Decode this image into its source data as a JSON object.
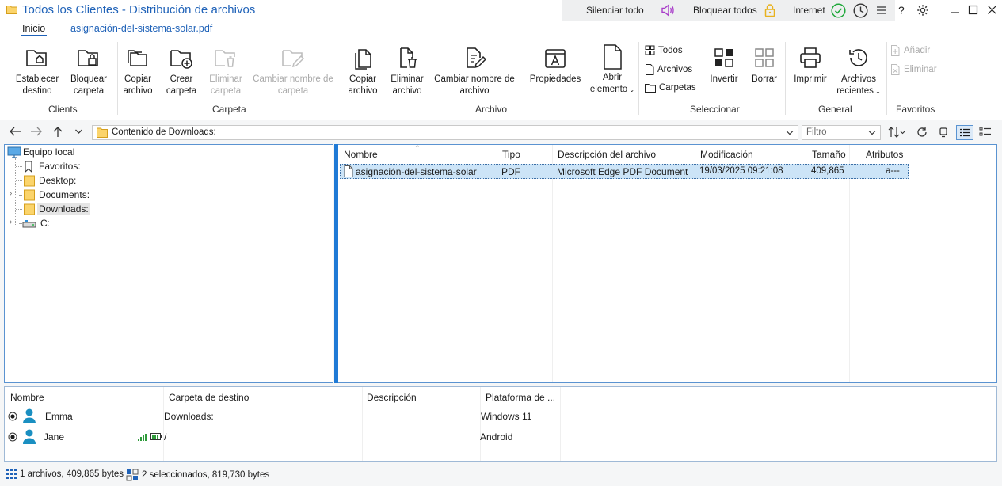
{
  "window": {
    "title": "Todos los Clientes - Distribución de archivos",
    "mute_all": "Silenciar todo",
    "lock_all": "Bloquear todos",
    "internet": "Internet",
    "help": "?"
  },
  "tabs": [
    {
      "label": "Inicio",
      "active": true
    },
    {
      "label": "asignación-del-sistema-solar.pdf",
      "active": false
    }
  ],
  "ribbon": {
    "clients": {
      "group": "Clients",
      "set_dest_1": "Establecer",
      "set_dest_2": "destino",
      "lock_folder_1": "Bloquear",
      "lock_folder_2": "carpeta"
    },
    "folder": {
      "group": "Carpeta",
      "copy_1": "Copiar",
      "copy_2": "archivo",
      "create_1": "Crear",
      "create_2": "carpeta",
      "delete_1": "Eliminar",
      "delete_2": "carpeta",
      "rename_1": "Cambiar nombre de",
      "rename_2": "carpeta"
    },
    "file": {
      "group": "Archivo",
      "copy_1": "Copiar",
      "copy_2": "archivo",
      "delete_1": "Eliminar",
      "delete_2": "archivo",
      "rename_1": "Cambiar nombre de",
      "rename_2": "archivo",
      "properties": "Propiedades",
      "open_1": "Abrir",
      "open_2": "elemento"
    },
    "select": {
      "group": "Seleccionar",
      "all": "Todos",
      "files": "Archivos",
      "folders": "Carpetas",
      "invert": "Invertir",
      "clear": "Borrar"
    },
    "general": {
      "group": "General",
      "print": "Imprimir",
      "recent_1": "Archivos",
      "recent_2": "recientes"
    },
    "favorites": {
      "group": "Favoritos",
      "add": "Añadir",
      "remove": "Eliminar"
    }
  },
  "address": {
    "path": "Contenido de Downloads:",
    "filter_placeholder": "Filtro"
  },
  "tree": {
    "root": "Equipo local",
    "items": [
      "Favoritos:",
      "Desktop:",
      "Documents:",
      "Downloads:",
      "C:"
    ],
    "selected": "Downloads:"
  },
  "files": {
    "columns": [
      "Nombre",
      "Tipo",
      "Descripción del archivo",
      "Modificación",
      "Tamaño",
      "Atributos"
    ],
    "rows": [
      {
        "name": "asignación-del-sistema-solar",
        "type": "PDF",
        "description": "Microsoft Edge PDF Document",
        "modified": "19/03/2025 09:21:08",
        "size": "409,865",
        "attributes": "a---"
      }
    ]
  },
  "clients": {
    "columns": [
      "Nombre",
      "Carpeta de destino",
      "Descripción",
      "Plataforma de ..."
    ],
    "rows": [
      {
        "name": "Emma",
        "destination": "Downloads:",
        "description": "",
        "platform": "Windows 11"
      },
      {
        "name": "Jane",
        "destination": "/",
        "description": "",
        "platform": "Android"
      }
    ]
  },
  "status": {
    "left": "1 archivos, 409,865 bytes",
    "right": "2 seleccionados, 819,730 bytes"
  },
  "colors": {
    "accent": "#1f62b8",
    "selection": "#cce4f7",
    "splitter": "#1f7ad6",
    "mute_icon": "#a83cc9",
    "lock_icon": "#e8b21f",
    "ok_icon": "#1fa83a",
    "user_icon": "#1a8fc1"
  }
}
